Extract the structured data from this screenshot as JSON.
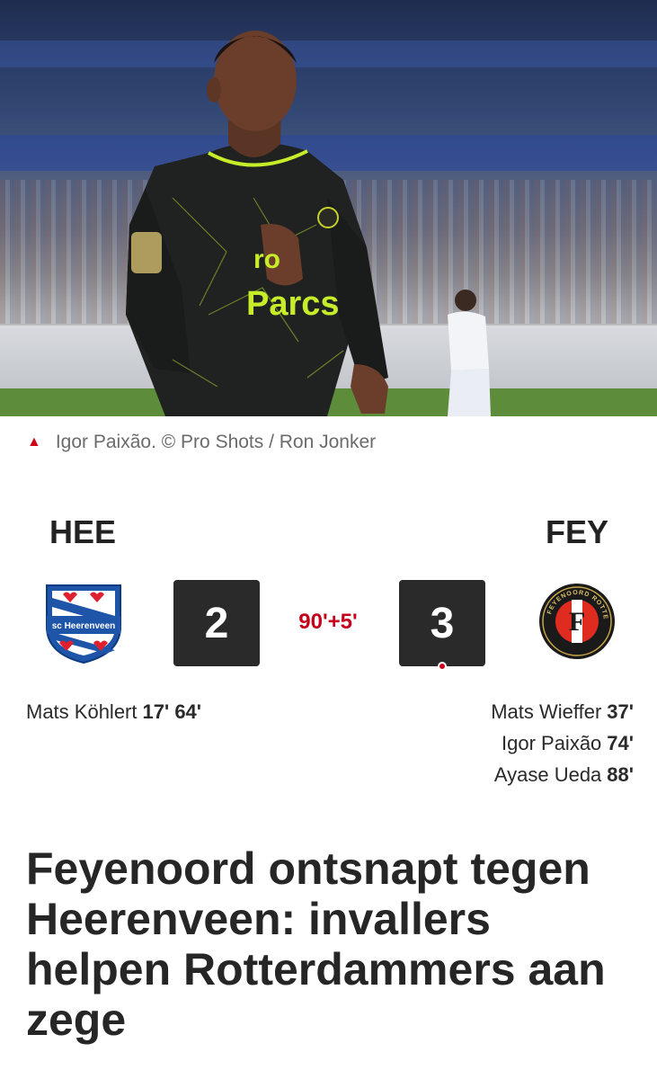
{
  "photo": {
    "caption": "Igor Paixão. © Pro Shots / Ron Jonker",
    "shirt_text_top": "ro",
    "shirt_text_bottom": "Parcs"
  },
  "match": {
    "home": {
      "abbr": "HEE",
      "crest_text": "sc Heerenveen",
      "score": "2",
      "scorers": [
        {
          "name": "Mats Köhlert",
          "minutes": "17' 64'"
        }
      ]
    },
    "away": {
      "abbr": "FEY",
      "crest_text": "FEYENOORD ROTTERDAM",
      "score": "3",
      "scorers": [
        {
          "name": "Mats Wieffer",
          "minutes": "37'"
        },
        {
          "name": "Igor Paixão",
          "minutes": "74'"
        },
        {
          "name": "Ayase Ueda",
          "minutes": "88'"
        }
      ]
    },
    "time": "90'+5'"
  },
  "article": {
    "headline": "Feyenoord ontsnapt tegen Heerenveen: invallers helpen Rotterdammers aan zege"
  },
  "colors": {
    "accent": "#d0021b",
    "time": "#c4001a",
    "scorebox": "#2a2a2a"
  }
}
